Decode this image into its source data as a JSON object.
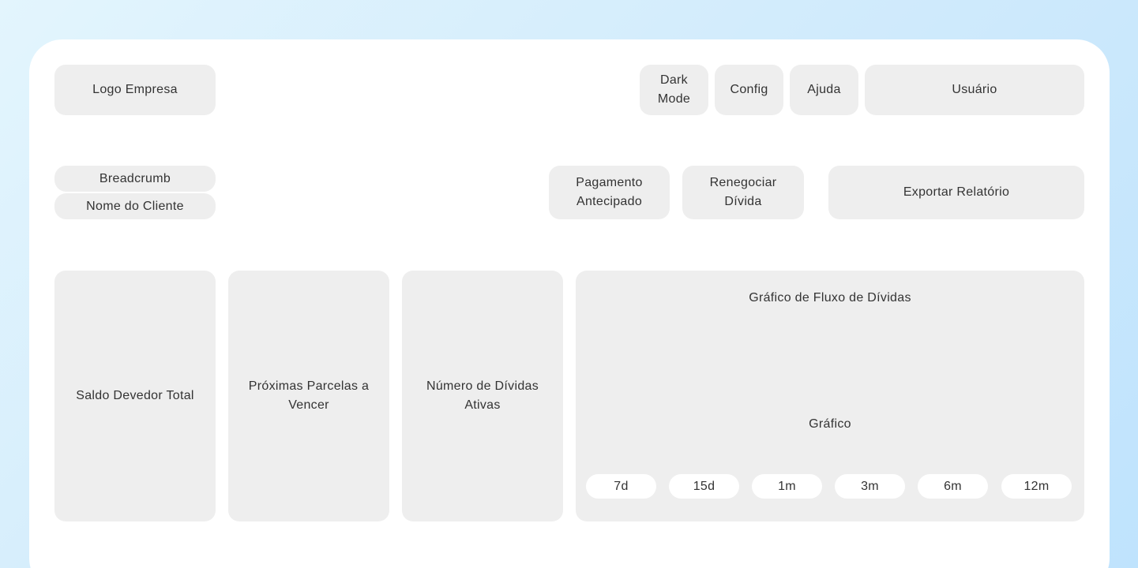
{
  "header": {
    "logo": "Logo Empresa",
    "dark_mode": "Dark Mode",
    "config": "Config",
    "help": "Ajuda",
    "user": "Usuário"
  },
  "subheader": {
    "breadcrumb": "Breadcrumb",
    "client_name": "Nome do Cliente",
    "early_payment": "Pagamento Antecipado",
    "renegotiate": "Renegociar Dívida",
    "export_report": "Exportar Relatório"
  },
  "cards": {
    "total_balance": "Saldo Devedor Total",
    "upcoming_installments": "Próximas Parcelas a Vencer",
    "active_debts": "Número de Dívidas Ativas"
  },
  "chart": {
    "title": "Gráfico de Fluxo de Dívidas",
    "placeholder": "Gráfico",
    "ranges": [
      "7d",
      "15d",
      "1m",
      "3m",
      "6m",
      "12m"
    ]
  },
  "colors": {
    "background_gradient_start": "#e3f5fd",
    "background_gradient_end": "#bfe3fd",
    "frame": "#ffffff",
    "placeholder_box": "#eeeeee",
    "text": "#333333"
  }
}
